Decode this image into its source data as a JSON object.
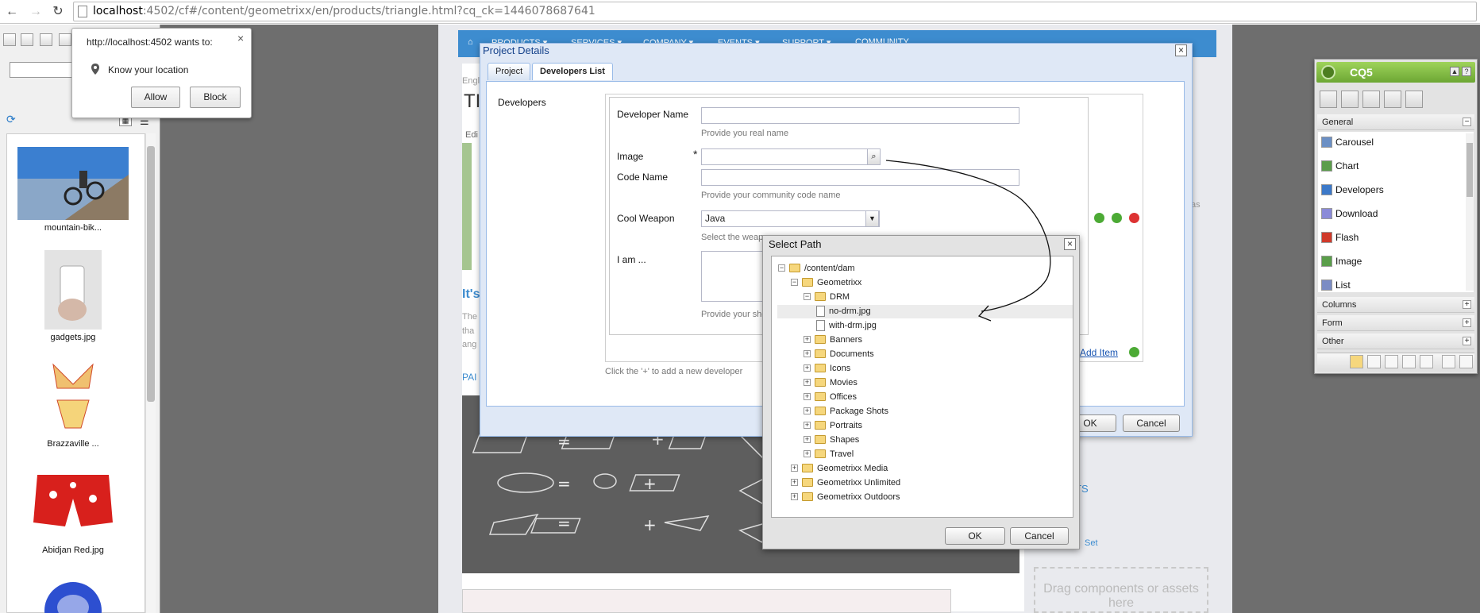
{
  "browser": {
    "url_host": "localhost",
    "url_rest": ":4502/cf#/content/geometrixx/en/products/triangle.html?cq_ck=1446078687641"
  },
  "permission": {
    "title": "http://localhost:4502 wants to:",
    "text": "Know your location",
    "allow": "Allow",
    "block": "Block",
    "close": "×"
  },
  "assets": [
    {
      "label": "mountain-bik..."
    },
    {
      "label": "gadgets.jpg"
    },
    {
      "label": "Brazzaville ..."
    },
    {
      "label": "Abidjan Red.jpg"
    }
  ],
  "page": {
    "nav": [
      "PRODUCTS ▾",
      "SERVICES ▾",
      "COMPANY ▾",
      "EVENTS ▾",
      "SUPPORT ▾",
      "COMMUNITY"
    ],
    "breadcrumb": "Engl",
    "heading": "TI",
    "edit": "Edi",
    "it": "It's",
    "para1": "The",
    "para2": "tha",
    "para3": "ang",
    "pa": "PAI",
    "as": "as",
    "ts": "TS",
    "set": "Set",
    "drop": "Drag components or assets here"
  },
  "sidekick": {
    "title": "CQ5",
    "min": "▲",
    "help": "?",
    "sections": {
      "general": "General",
      "columns": "Columns",
      "form": "Form",
      "other": "Other"
    },
    "items": [
      {
        "label": "Carousel",
        "color": "#6b8fc4"
      },
      {
        "label": "Chart",
        "color": "#5b9d4b"
      },
      {
        "label": "Developers",
        "color": "#3c79c9"
      },
      {
        "label": "Download",
        "color": "#8a8ad8"
      },
      {
        "label": "Flash",
        "color": "#d03a2a"
      },
      {
        "label": "Image",
        "color": "#5a9e4a"
      },
      {
        "label": "List",
        "color": "#7b8cc4"
      }
    ]
  },
  "dialog": {
    "title": "Project Details",
    "close": "×",
    "tabs": [
      "Project",
      "Developers List"
    ],
    "section": "Developers",
    "dev_name_label": "Developer Name",
    "dev_name_hint": "Provide you real name",
    "image_label": "Image",
    "required": "*",
    "code_label": "Code Name",
    "code_hint": "Provide your community code name",
    "weapon_label": "Cool Weapon",
    "weapon_value": "Java",
    "weapon_hint": "Select the weapon you wish to use against the bugs",
    "iam_label": "I am ...",
    "iam_hint": "Provide your sho",
    "add_item": "Add Item",
    "add_hint": "Click the '+' to add a new developer",
    "ok": "OK",
    "cancel": "Cancel"
  },
  "select_path": {
    "title": "Select Path",
    "close": "×",
    "ok": "OK",
    "cancel": "Cancel",
    "tree": [
      {
        "label": "/content/dam",
        "level": 0,
        "type": "folder",
        "tog": "−"
      },
      {
        "label": "Geometrixx",
        "level": 1,
        "type": "folder",
        "tog": "−"
      },
      {
        "label": "DRM",
        "level": 2,
        "type": "folder",
        "tog": "−"
      },
      {
        "label": "no-drm.jpg",
        "level": 3,
        "type": "file",
        "tog": ""
      },
      {
        "label": "with-drm.jpg",
        "level": 3,
        "type": "file",
        "tog": ""
      },
      {
        "label": "Banners",
        "level": 2,
        "type": "folder",
        "tog": "+"
      },
      {
        "label": "Documents",
        "level": 2,
        "type": "folder",
        "tog": "+"
      },
      {
        "label": "Icons",
        "level": 2,
        "type": "folder",
        "tog": "+"
      },
      {
        "label": "Movies",
        "level": 2,
        "type": "folder",
        "tog": "+"
      },
      {
        "label": "Offices",
        "level": 2,
        "type": "folder",
        "tog": "+"
      },
      {
        "label": "Package Shots",
        "level": 2,
        "type": "folder",
        "tog": "+"
      },
      {
        "label": "Portraits",
        "level": 2,
        "type": "folder",
        "tog": "+"
      },
      {
        "label": "Shapes",
        "level": 2,
        "type": "folder",
        "tog": "+"
      },
      {
        "label": "Travel",
        "level": 2,
        "type": "folder",
        "tog": "+"
      },
      {
        "label": "Geometrixx Media",
        "level": 1,
        "type": "folder",
        "tog": "+"
      },
      {
        "label": "Geometrixx Unlimited",
        "level": 1,
        "type": "folder",
        "tog": "+"
      },
      {
        "label": "Geometrixx Outdoors",
        "level": 1,
        "type": "folder",
        "tog": "+"
      }
    ]
  }
}
